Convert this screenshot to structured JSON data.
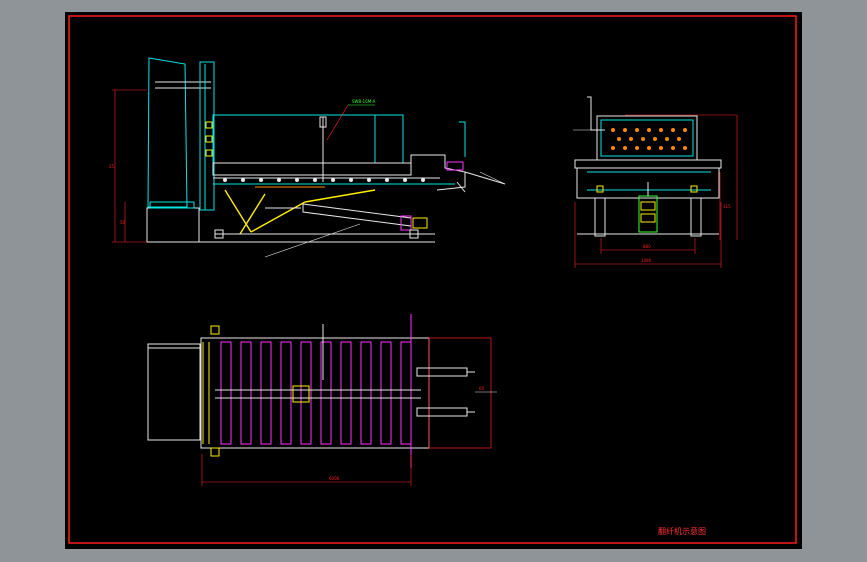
{
  "viewport": {
    "background": "#8f9499"
  },
  "sheet": {
    "background": "#000000",
    "border_color": "#ff1a1a"
  },
  "title_block": {
    "text": "翻纤机示意图",
    "color": "#ff3333"
  },
  "callouts": {
    "side_view_label": "SWB-16M-A",
    "side_dimension_total": "25",
    "side_dimension_lower": "50",
    "end_dimension_inner": "880",
    "end_dimension_outer": "1480",
    "end_dimension_height": "315",
    "plan_dimension_length": "6000",
    "plan_dimension_small": "60"
  },
  "colors": {
    "frame_white": "#e8e8e8",
    "cyan": "#00e5e5",
    "magenta": "#ff33ff",
    "yellow": "#ffee00",
    "green": "#33ff33",
    "red": "#ff2222",
    "orange": "#ff8800"
  }
}
